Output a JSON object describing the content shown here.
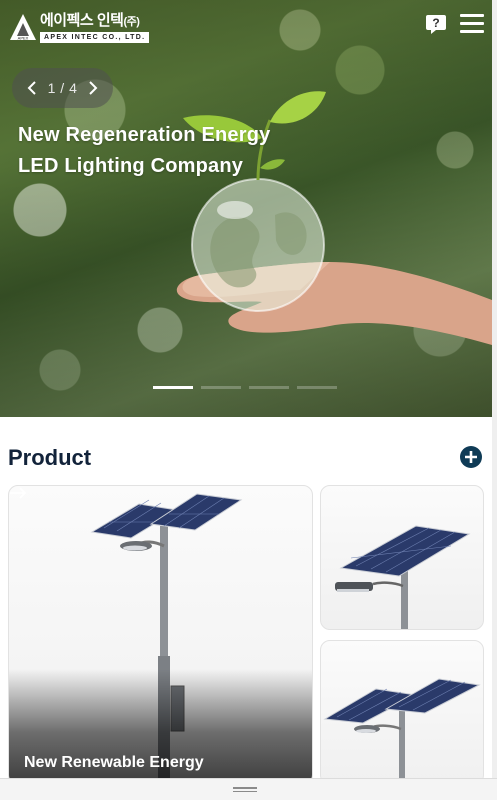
{
  "header": {
    "logo_korean": "에이펙스 인텍",
    "logo_suffix": "(주)",
    "logo_english": "APEX INTEC CO., LTD.",
    "logo_mark_text": "APEX",
    "help_icon": "question-bubble-icon",
    "menu_icon": "hamburger-menu-icon"
  },
  "hero": {
    "slide_current": 1,
    "slide_total": 4,
    "pager_text": "1 / 4",
    "title_line1": "New Regeneration Energy",
    "title_line2": "LED Lighting Company",
    "dots": [
      {
        "active": true
      },
      {
        "active": false
      },
      {
        "active": false
      },
      {
        "active": false
      }
    ]
  },
  "product": {
    "heading": "Product",
    "more_icon": "plus-circle-icon",
    "accent_color": "#0f3b56",
    "cards": [
      {
        "caption": "New Renewable Energy",
        "arrow_icon": "arrow-right-icon"
      },
      {
        "caption": ""
      },
      {
        "caption": ""
      }
    ]
  }
}
